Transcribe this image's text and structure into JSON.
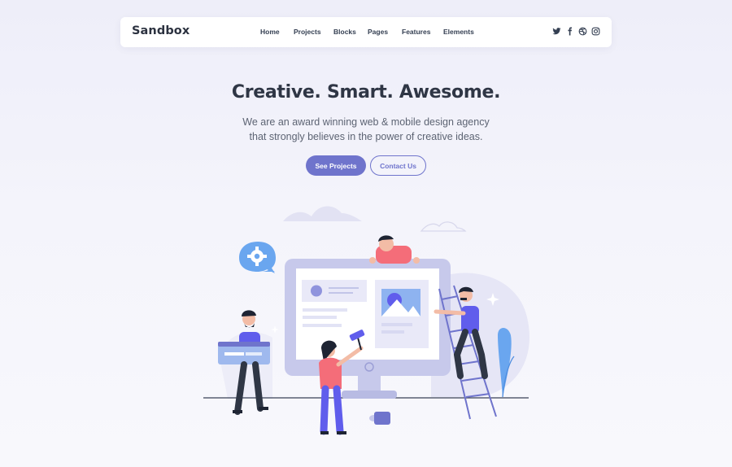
{
  "brand": {
    "logo": "Sandbox"
  },
  "nav": {
    "items": [
      {
        "label": "Home"
      },
      {
        "label": "Projects"
      },
      {
        "label": "Blocks"
      },
      {
        "label": "Pages"
      },
      {
        "label": "Features"
      },
      {
        "label": "Elements"
      }
    ],
    "social_icons": [
      "twitter-icon",
      "facebook-icon",
      "dribbble-icon",
      "instagram-icon"
    ]
  },
  "hero": {
    "title": "Creative. Smart. Awesome.",
    "subtitle_line1": "We are an award winning web & mobile design agency",
    "subtitle_line2": "that strongly believes in the power of creative ideas.",
    "primary_button": "See Projects",
    "secondary_button": "Contact Us"
  },
  "colors": {
    "accent": "#6f74cc",
    "purple": "#605dec",
    "pink": "#f46d79",
    "light_blue": "#6aa6ef",
    "text_dark": "#2f3645"
  }
}
